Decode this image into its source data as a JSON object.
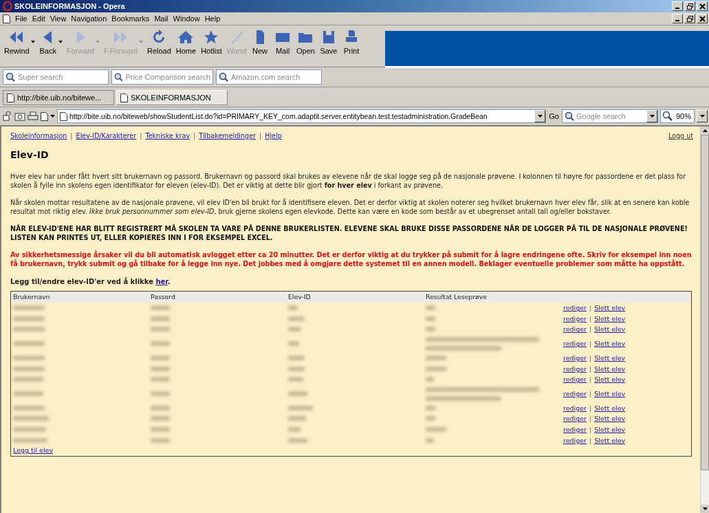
{
  "window": {
    "title": "SKOLEINFORMASJON - Opera"
  },
  "menu": [
    "File",
    "Edit",
    "View",
    "Navigation",
    "Bookmarks",
    "Mail",
    "Window",
    "Help"
  ],
  "toolbar": [
    {
      "kind": "rewind",
      "label": "Rewind",
      "disabled": false,
      "dropdown": true
    },
    {
      "kind": "back",
      "label": "Back",
      "disabled": false,
      "dropdown": true
    },
    {
      "kind": "forward",
      "label": "Forward",
      "disabled": true,
      "dropdown": true
    },
    {
      "kind": "fforward",
      "label": "F.Forward",
      "disabled": true,
      "dropdown": true
    },
    {
      "kind": "reload",
      "label": "Reload",
      "disabled": false,
      "dropdown": false
    },
    {
      "kind": "home",
      "label": "Home",
      "disabled": false,
      "dropdown": false
    },
    {
      "kind": "hotlist",
      "label": "Hotlist",
      "disabled": false,
      "dropdown": false
    },
    {
      "kind": "wand",
      "label": "Wand",
      "disabled": true,
      "dropdown": false
    },
    {
      "kind": "new",
      "label": "New",
      "disabled": false,
      "dropdown": false
    },
    {
      "kind": "mail",
      "label": "Mail",
      "disabled": false,
      "dropdown": false
    },
    {
      "kind": "open",
      "label": "Open",
      "disabled": false,
      "dropdown": false
    },
    {
      "kind": "save",
      "label": "Save",
      "disabled": false,
      "dropdown": false
    },
    {
      "kind": "print",
      "label": "Print",
      "disabled": false,
      "dropdown": false
    }
  ],
  "search_fields": [
    {
      "placeholder": "Super search"
    },
    {
      "placeholder": "Price Comparison search"
    },
    {
      "placeholder": "Amazon.com search"
    }
  ],
  "tabs": [
    {
      "label": "http://bite.uib.no/bitewe...",
      "selected": false
    },
    {
      "label": "SKOLEINFORMASJON",
      "selected": true
    }
  ],
  "address_bar": {
    "url": "http://bite.uib.no/biteweb/showStudentList.do?id=PRIMARY_KEY_com.adaptit.server.entitybean.test.testadministration.GradeBean",
    "go": "Go",
    "search_placeholder": "Google search",
    "zoom": "90%"
  },
  "page": {
    "nav": [
      {
        "label": "Skoleinformasjon"
      },
      {
        "separator": "|",
        "label": "Elev-ID/Karakterer"
      },
      {
        "separator": "|",
        "label": "Tekniske krav"
      },
      {
        "separator": "|",
        "label": "Tilbakemeldinger"
      },
      {
        "separator": "|",
        "label": "Hjelp"
      }
    ],
    "logout": "Logg ut",
    "heading": "Elev-ID",
    "paragraphs": [
      {
        "kind": "normal",
        "text": "Hver elev har under fått hvert sitt brukernavn og passord. Brukernavn og passord skal brukes av elevene når de skal logge seg på de nasjonale prøvene. I kolonnen til høyre for passordene er det plass for skolen å fylle inn skolens egen identifikator for eleven (elev-ID). Det er viktig at dette blir gjort **for hver elev** i forkant av prøvene."
      },
      {
        "kind": "normal",
        "text": "Når skolen mottar resultatene av de nasjonale prøvene, vil elev ID'en bli brukt for å identifisere eleven. Det er derfor viktig at skolen noterer seg hvilket brukernavn hver elev får, slik at en senere kan koble resultat mot riktig elev. *Ikke bruk personnummer som elev-ID*, bruk gjerne skolens egen elevkode. Dette kan være en kode som består av et ubegrenset antall tall og/eller bokstaver."
      },
      {
        "kind": "bold",
        "text": "NÅR ELEV-ID'ENE HAR BLITT REGISTRERT MÅ SKOLEN TA VARE PÅ DENNE BRUKERLISTEN. ELEVENE SKAL BRUKE DISSE PASSORDENE NÅR DE LOGGER PÅ TIL DE NASJONALE PRØVENE! LISTEN KAN PRINTES UT, ELLER KOPIERES INN I FOR EKSEMPEL EXCEL."
      },
      {
        "kind": "warning",
        "text": "Av sikkerhetsmessige årsaker vil du bli automatisk avlogget etter ca 20 minutter. Det er derfor viktig at du trykker på submit for å lagre endringene ofte. Skriv for eksempel inn noen få brukernavn, trykk submit og gå tilbake for å legge inn nye. Det jobbes med å omgjøre dette systemet til en annen modell. Beklager eventuelle problemer som måtte ha oppstått."
      }
    ],
    "edit_prompt": "Legg til/endre elev-ID'er ved å klikke ",
    "edit_link": "her",
    "edit_prompt_end": ".",
    "table": {
      "columns": [
        "Brukernavn",
        "Passord",
        "Elev-ID",
        "Resultat Leseprøve"
      ],
      "rows": [
        {
          "kind": "short",
          "edit": "rediger",
          "separator": "|",
          "delete": "Slett elev"
        },
        {
          "kind": "short",
          "edit": "rediger",
          "separator": "|",
          "delete": "Slett elev"
        },
        {
          "kind": "short",
          "edit": "rediger",
          "separator": "|",
          "delete": "Slett elev"
        },
        {
          "kind": "long",
          "edit": "rediger",
          "separator": "|",
          "delete": "Slett elev"
        },
        {
          "kind": "short",
          "edit": "rediger",
          "separator": "|",
          "delete": "Slett elev"
        },
        {
          "kind": "short",
          "edit": "rediger",
          "separator": "|",
          "delete": "Slett elev"
        },
        {
          "kind": "short",
          "edit": "rediger",
          "separator": "|",
          "delete": "Slett elev"
        },
        {
          "kind": "long",
          "edit": "rediger",
          "separator": "|",
          "delete": "Slett elev"
        },
        {
          "kind": "short",
          "edit": "rediger",
          "separator": "|",
          "delete": "Slett elev"
        },
        {
          "kind": "short",
          "edit": "rediger",
          "separator": "|",
          "delete": "Slett elev"
        },
        {
          "kind": "short",
          "edit": "rediger",
          "separator": "|",
          "delete": "Slett elev"
        },
        {
          "kind": "short",
          "edit": "rediger",
          "separator": "|",
          "delete": "Slett elev"
        }
      ],
      "add": "Legg til elev"
    }
  }
}
